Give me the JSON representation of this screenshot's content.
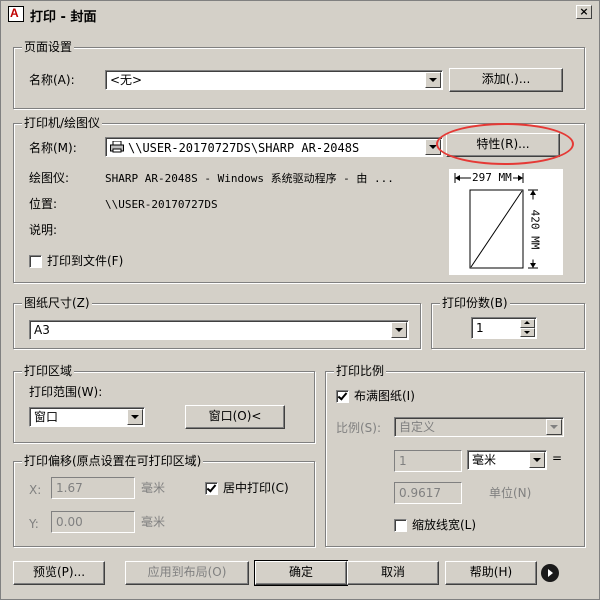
{
  "window": {
    "title": "打印 - 封面",
    "app_icon_letter": "A"
  },
  "page_setup": {
    "legend": "页面设置",
    "name_label": "名称(A):",
    "name_value": "<无>",
    "add_button": "添加(.)..."
  },
  "printer": {
    "legend": "打印机/绘图仪",
    "name_label": "名称(M):",
    "name_value": "\\\\USER-20170727DS\\SHARP AR-2048S",
    "properties_button": "特性(R)...",
    "plotter_label": "绘图仪:",
    "plotter_value": "SHARP AR-2048S - Windows 系统驱动程序 - 由 ...",
    "location_label": "位置:",
    "location_value": "\\\\USER-20170727DS",
    "description_label": "说明:",
    "print_to_file_label": "打印到文件(F)",
    "print_to_file_checked": false,
    "preview_width_label": "297 MM",
    "preview_height_label": "420 MM"
  },
  "paper_size": {
    "legend": "图纸尺寸(Z)",
    "value": "A3"
  },
  "copies": {
    "legend": "打印份数(B)",
    "value": "1"
  },
  "print_area": {
    "legend": "打印区域",
    "range_label": "打印范围(W):",
    "range_value": "窗口",
    "window_button": "窗口(O)<"
  },
  "print_offset": {
    "legend": "打印偏移(原点设置在可打印区域)",
    "x_label": "X:",
    "x_value": "1.67",
    "y_label": "Y:",
    "y_value": "0.00",
    "unit": "毫米",
    "center_label": "居中打印(C)",
    "center_checked": true
  },
  "print_scale": {
    "legend": "打印比例",
    "fit_label": "布满图纸(I)",
    "fit_checked": true,
    "scale_label": "比例(S):",
    "scale_value": "自定义",
    "value1": "1",
    "unit1": "毫米",
    "equals": "=",
    "value2": "0.9617",
    "unit2": "单位(N)",
    "lineweights_label": "缩放线宽(L)",
    "lineweights_checked": false
  },
  "footer": {
    "preview_button": "预览(P)...",
    "apply_button": "应用到布局(O)",
    "ok_button": "确定",
    "cancel_button": "取消",
    "help_button": "帮助(H)"
  }
}
